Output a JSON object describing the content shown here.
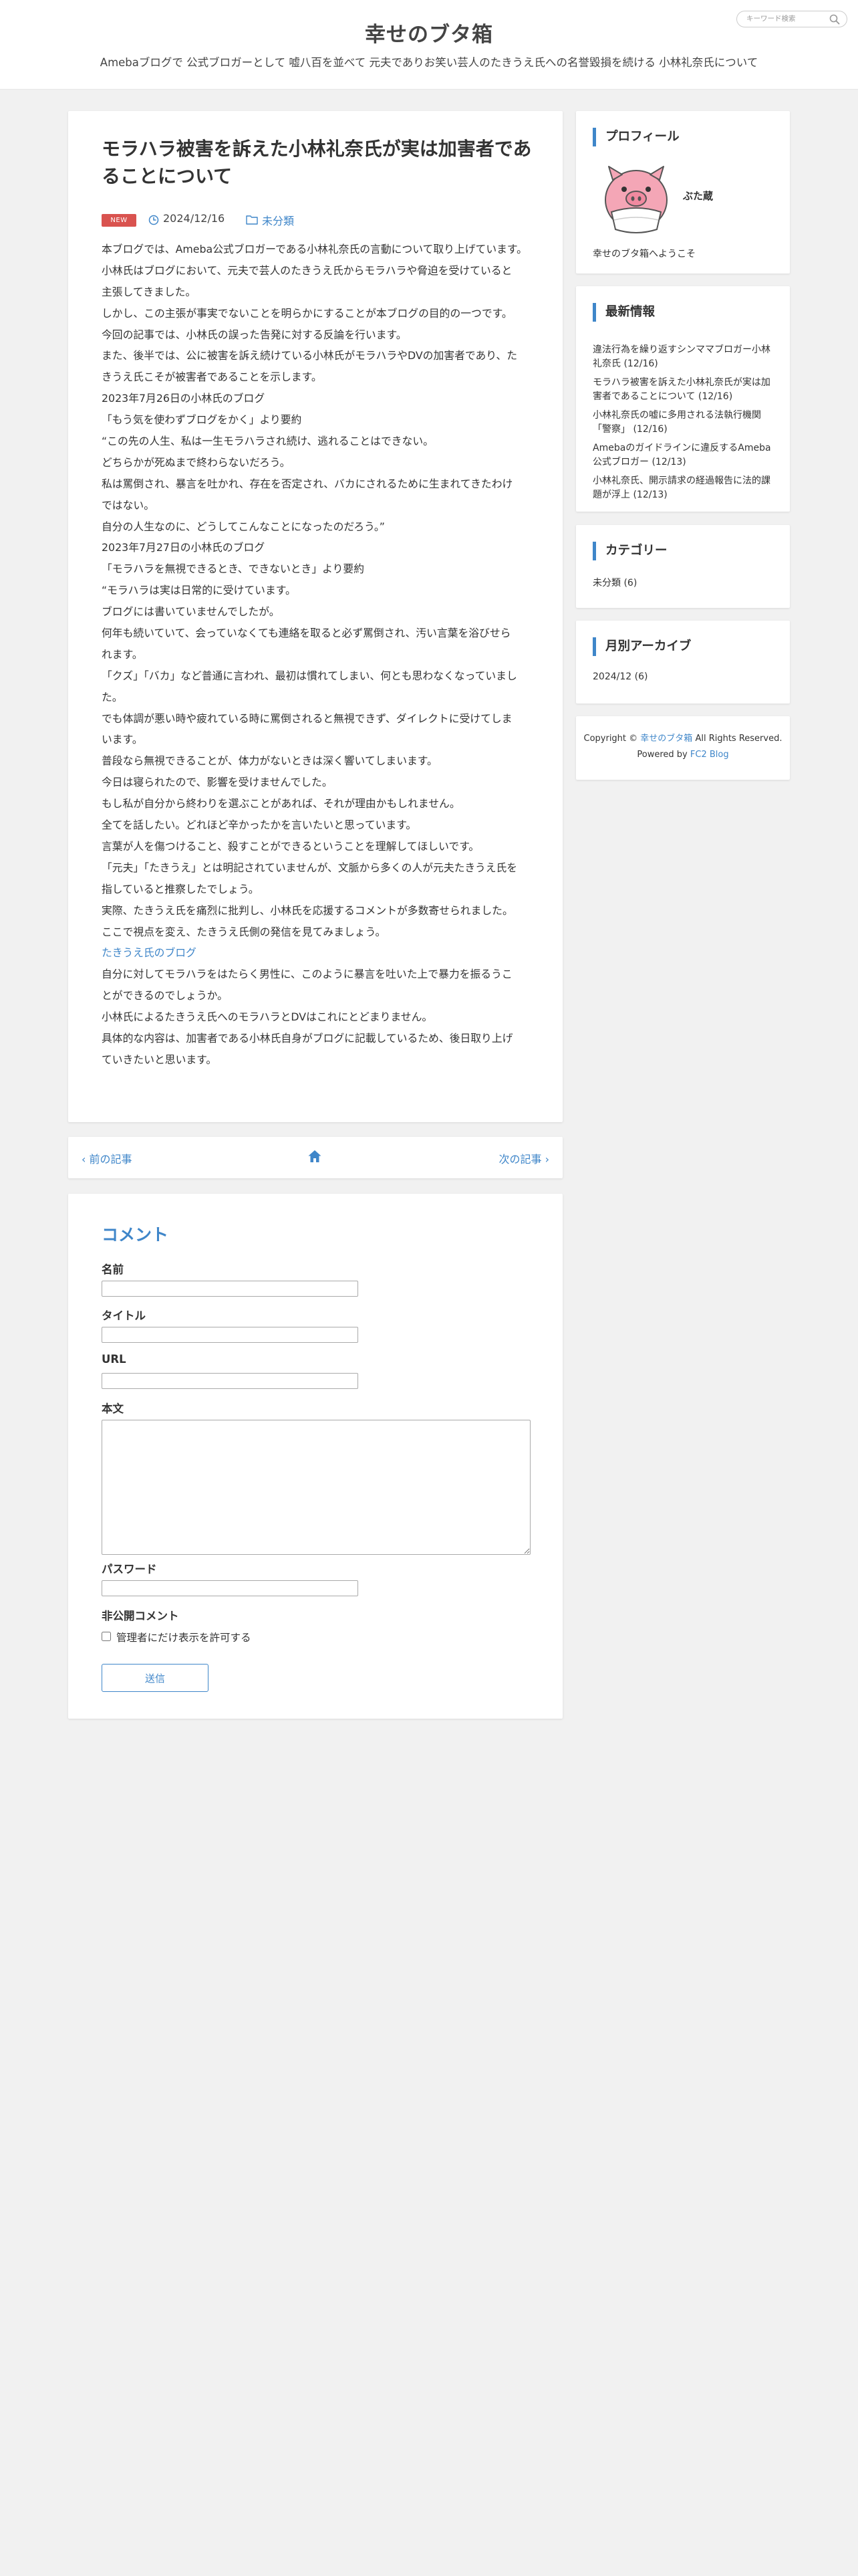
{
  "header": {
    "site_title": "幸せのブタ箱",
    "site_description": "Amebaブログで 公式ブロガーとして 嘘八百を並べて 元夫でありお笑い芸人のたきうえ氏への名誉毀損を続ける 小林礼奈氏について",
    "search_placeholder": "キーワード検索"
  },
  "article": {
    "title": "モラハラ被害を訴えた小林礼奈氏が実は加害者であることについて",
    "badge": "NEW",
    "date": "2024/12/16",
    "category": "未分類",
    "lines": [
      {
        "text": "本ブログでは、Ameba公式ブロガーである小林礼奈氏の言動について取り上げています。"
      },
      {
        "text": "小林氏はブログにおいて、元夫で芸人のたきうえ氏からモラハラや脅迫を受けていると"
      },
      {
        "text": "主張してきました。"
      },
      {
        "text": "しかし、この主張が事実でないことを明らかにすることが本ブログの目的の一つです。"
      },
      {
        "text": "今回の記事では、小林氏の誤った告発に対する反論を行います。"
      },
      {
        "text": "また、後半では、公に被害を訴え続けている小林氏がモラハラやDVの加害者であり、た"
      },
      {
        "text": "きうえ氏こそが被害者であることを示します。"
      },
      {
        "text": "2023年7月26日の小林氏のブログ"
      },
      {
        "text": "「もう気を使わずブログをかく」より要約"
      },
      {
        "text": "“この先の人生、私は一生モラハラされ続け、逃れることはできない。"
      },
      {
        "text": "どちらかが死ぬまで終わらないだろう。"
      },
      {
        "text": "私は罵倒され、暴言を吐かれ、存在を否定され、バカにされるために生まれてきたわけ"
      },
      {
        "text": "ではない。"
      },
      {
        "text": "自分の人生なのに、どうしてこんなことになったのだろう。”"
      },
      {
        "text": "2023年7月27日の小林氏のブログ"
      },
      {
        "text": "「モラハラを無視できるとき、できないとき」より要約"
      },
      {
        "text": "“モラハラは実は日常的に受けています。"
      },
      {
        "text": "ブログには書いていませんでしたが。"
      },
      {
        "text": "何年も続いていて、会っていなくても連絡を取ると必ず罵倒され、汚い言葉を浴びせら"
      },
      {
        "text": "れます。"
      },
      {
        "text": "「クズ」「バカ」など普通に言われ、最初は慣れてしまい、何とも思わなくなっていまし"
      },
      {
        "text": "た。"
      },
      {
        "text": "でも体調が悪い時や疲れている時に罵倒されると無視できず、ダイレクトに受けてしま"
      },
      {
        "text": "います。"
      },
      {
        "text": "普段なら無視できることが、体力がないときは深く響いてしまいます。"
      },
      {
        "text": "今日は寝られたので、影響を受けませんでした。"
      },
      {
        "text": "もし私が自分から終わりを選ぶことがあれば、それが理由かもしれません。"
      },
      {
        "text": "全てを話したい。どれほど辛かったかを言いたいと思っています。"
      },
      {
        "text": "言葉が人を傷つけること、殺すことができるということを理解してほしいです。"
      },
      {
        "text": "「元夫」「たきうえ」とは明記されていませんが、文脈から多くの人が元夫たきうえ氏を"
      },
      {
        "text": "指していると推察したでしょう。"
      },
      {
        "text": "実際、たきうえ氏を痛烈に批判し、小林氏を応援するコメントが多数寄せられました。"
      },
      {
        "text": "ここで視点を変え、たきうえ氏側の発信を見てみましょう。"
      },
      {
        "text": "たきうえ氏のブログ",
        "link": true
      },
      {
        "text": "自分に対してモラハラをはたらく男性に、このように暴言を吐いた上で暴力を振るうこ"
      },
      {
        "text": "とができるのでしょうか。"
      },
      {
        "text": "小林氏によるたきうえ氏へのモラハラとDVはこれにとどまりません。"
      },
      {
        "text": "具体的な内容は、加害者である小林氏自身がブログに記載しているため、後日取り上げ"
      },
      {
        "text": "ていきたいと思います。"
      }
    ]
  },
  "pager": {
    "prev_label": "前の記事",
    "next_label": "次の記事"
  },
  "comment_form": {
    "heading": "コメント",
    "name_label": "名前",
    "title_label": "タイトル",
    "url_label": "URL",
    "body_label": "本文",
    "password_label": "パスワード",
    "private_label": "非公開コメント",
    "private_checkbox_label": "管理者にだけ表示を許可する",
    "submit_label": "送信"
  },
  "sidebar": {
    "profile": {
      "heading": "プロフィール",
      "name": "ぶた蔵",
      "welcome": "幸せのブタ箱へようこそ"
    },
    "latest": {
      "heading": "最新情報",
      "items": [
        "違法行為を繰り返すシンママブロガー小林礼奈氏 (12/16)",
        "モラハラ被害を訴えた小林礼奈氏が実は加害者であることについて (12/16)",
        "小林礼奈氏の嘘に多用される法執行機関「警察」 (12/16)",
        "Amebaのガイドラインに違反するAmeba公式ブロガー (12/13)",
        "小林礼奈氏、開示請求の経過報告に法的課題が浮上 (12/13)"
      ]
    },
    "categories": {
      "heading": "カテゴリー",
      "items": [
        "未分類 (6)"
      ]
    },
    "archives": {
      "heading": "月別アーカイブ",
      "items": [
        "2024/12 (6)"
      ]
    },
    "copyright": {
      "prefix": "Copyright ©",
      "site_link": "幸せのブタ箱",
      "rights": "All Rights Reserved.",
      "powered_by": "Powered by",
      "powered_link": "FC2 Blog"
    }
  },
  "colors": {
    "accent": "#3f86c9",
    "badge": "#d9534f",
    "background": "#f1f1f1",
    "card": "#ffffff",
    "pig_pink": "#f4a6b6"
  }
}
